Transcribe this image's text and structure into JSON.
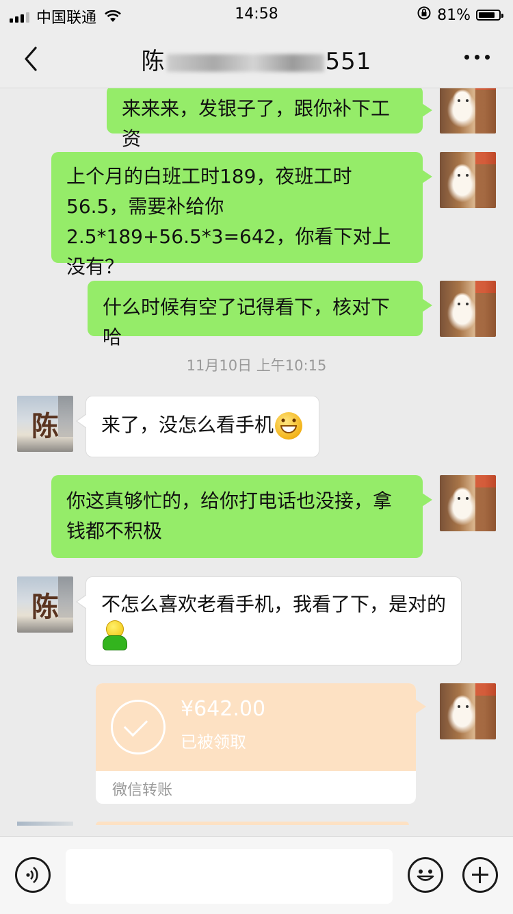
{
  "status_bar": {
    "carrier": "中国联通",
    "time": "14:58",
    "battery": "81%",
    "battery_level": 0.81
  },
  "nav": {
    "title_prefix": "陈",
    "title_suffix": "551",
    "back_icon": "chevron-left-icon",
    "more_icon": "more-dots-icon"
  },
  "messages": [
    {
      "side": "right",
      "text": "来来来，发银子了，跟你补下工资"
    },
    {
      "side": "right",
      "text": "上个月的白班工时189，夜班工时56.5，需要补给你2.5*189+56.5*3=642，你看下对上没有？"
    },
    {
      "side": "right",
      "text": "什么时候有空了记得看下，核对下哈"
    },
    {
      "type": "timestamp",
      "text": "11月10日 上午10:15"
    },
    {
      "side": "left",
      "text": "来了，没怎么看手机"
    },
    {
      "side": "right",
      "text": "你这真够忙的，给你打电话也没接，拿钱都不积极"
    },
    {
      "side": "left",
      "text": "不怎么喜欢老看手机，我看了下，是对的"
    }
  ],
  "contact_avatar_char": "陈",
  "transfer": {
    "amount": "¥642.00",
    "status": "已被领取",
    "label": "微信转账",
    "color": "#fde1c3"
  },
  "input_bar": {
    "value": "",
    "icons": [
      "voice-icon",
      "emoji-icon",
      "plus-icon"
    ]
  },
  "colors": {
    "sent_bubble": "#95ec69",
    "received_bubble": "#ffffff",
    "background": "#ebebeb"
  }
}
